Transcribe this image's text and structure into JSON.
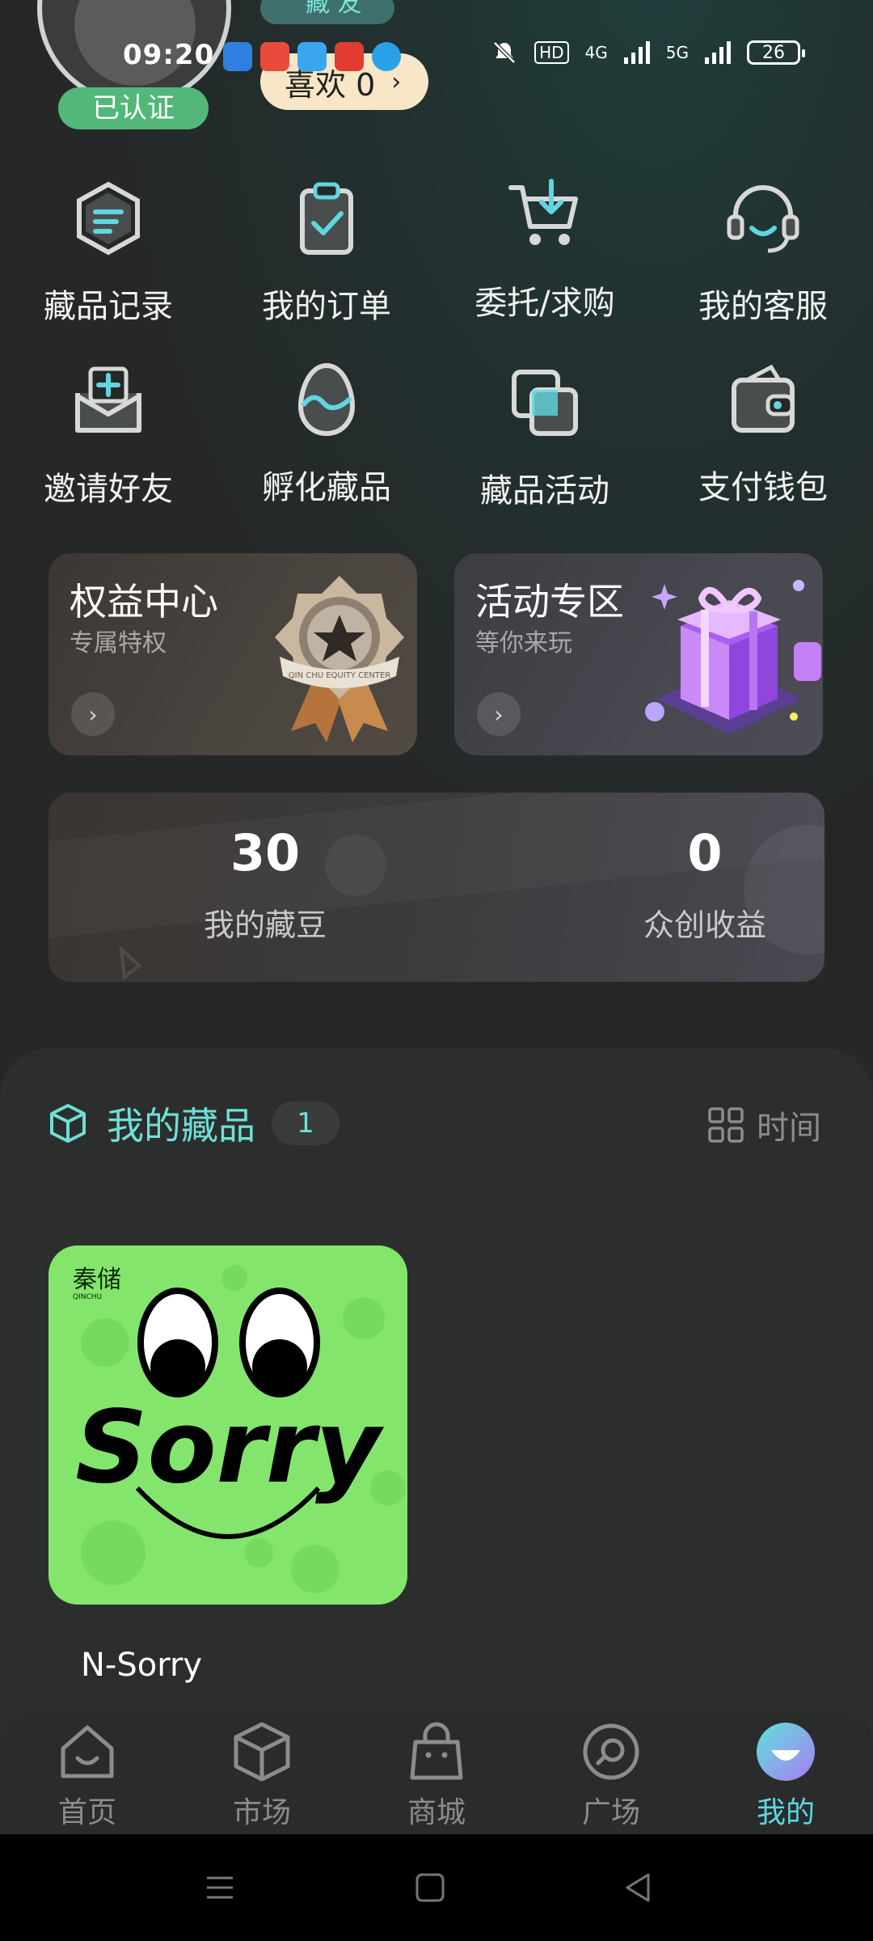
{
  "status": {
    "time": "09:20",
    "network1": "4G",
    "network2": "5G",
    "hd": "HD",
    "battery": "26"
  },
  "profile": {
    "verified_label": "已认证",
    "tag_label": "藏 友",
    "likes_label": "喜欢 0",
    "chevron": "›"
  },
  "menu": [
    {
      "label": "藏品记录",
      "icon": "collection-record-icon"
    },
    {
      "label": "我的订单",
      "icon": "order-clipboard-icon"
    },
    {
      "label": "委托/求购",
      "icon": "cart-icon"
    },
    {
      "label": "我的客服",
      "icon": "headset-icon"
    },
    {
      "label": "邀请好友",
      "icon": "invite-envelope-icon"
    },
    {
      "label": "孵化藏品",
      "icon": "egg-icon"
    },
    {
      "label": "藏品活动",
      "icon": "activity-squares-icon"
    },
    {
      "label": "支付钱包",
      "icon": "wallet-icon"
    }
  ],
  "cards": {
    "benefits": {
      "title": "权益中心",
      "subtitle": "专属特权",
      "badge_text": "QIN CHU EQUITY CENTER"
    },
    "activity": {
      "title": "活动专区",
      "subtitle": "等你来玩"
    }
  },
  "stats": {
    "beans": {
      "value": "30",
      "label": "我的藏豆"
    },
    "earnings": {
      "value": "0",
      "label": "众创收益"
    }
  },
  "collection": {
    "title": "我的藏品",
    "count": "1",
    "sort_label": "时间",
    "items": [
      {
        "name": "N-Sorry",
        "art_text": "Sorry",
        "brand": "秦储",
        "brand_sub": "QINCHU"
      }
    ]
  },
  "nav": [
    {
      "label": "首页",
      "icon": "home-icon"
    },
    {
      "label": "市场",
      "icon": "cube-icon"
    },
    {
      "label": "商城",
      "icon": "shopping-bag-icon"
    },
    {
      "label": "广场",
      "icon": "chat-bubble-icon"
    },
    {
      "label": "我的",
      "icon": "profile-face-icon",
      "active": true
    }
  ],
  "colors": {
    "accent": "#5fd6e0",
    "verified": "#52b779",
    "likes_bg": "#f7e7c6",
    "nft_bg": "#84e56c"
  }
}
